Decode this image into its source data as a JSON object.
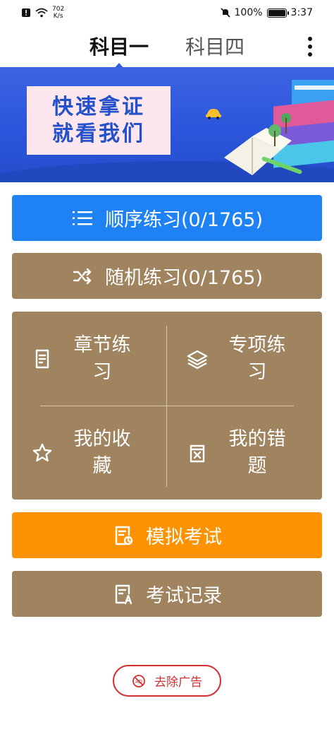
{
  "statusbar": {
    "net_speed_value": "702",
    "net_speed_unit": "K/s",
    "battery": "100%",
    "time": "3:37"
  },
  "tabs": [
    {
      "label": "科目一",
      "active": true
    },
    {
      "label": "科目四",
      "active": false
    }
  ],
  "banner": {
    "line1": "快速拿证",
    "line2": "就看我们"
  },
  "buttons": {
    "sequential": "顺序练习(0/1765)",
    "random": "随机练习(0/1765)",
    "mock_exam": "模拟考试",
    "exam_record": "考试记录"
  },
  "grid": {
    "chapter": "章节练习",
    "special": "专项练习",
    "favorites": "我的收藏",
    "mistakes": "我的错题"
  },
  "ad_button": "去除广告",
  "colors": {
    "blue": "#1e82f4",
    "tan": "#a0835f",
    "orange": "#ff9200",
    "ad_red": "#d43030"
  }
}
